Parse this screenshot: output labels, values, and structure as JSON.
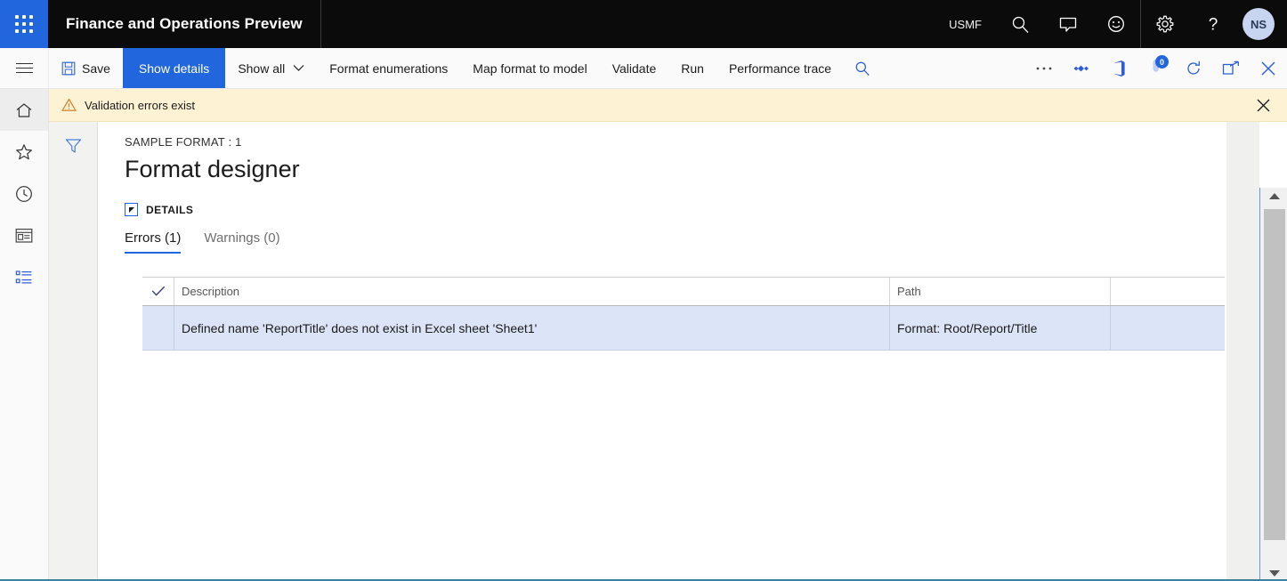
{
  "topbar": {
    "waffle_label": "App launcher",
    "app_title": "Finance and Operations Preview",
    "company": "USMF",
    "icons": [
      {
        "name": "search-icon",
        "label": "Search"
      },
      {
        "name": "message-icon",
        "label": "Messages"
      },
      {
        "name": "feedback-smiley-icon",
        "label": "Feedback"
      },
      {
        "name": "settings-gear-icon",
        "label": "Settings"
      },
      {
        "name": "help-question-icon",
        "label": "Help"
      }
    ],
    "avatar_initials": "NS"
  },
  "toolbar": {
    "hamburger_label": "Expand the navigation pane",
    "save_label": "Save",
    "show_details_label": "Show details",
    "show_all_label": "Show all",
    "show_all_chevron": "⌄",
    "format_enumerations_label": "Format enumerations",
    "map_format_to_model_label": "Map format to model",
    "validate_label": "Validate",
    "run_label": "Run",
    "performance_trace_label": "Performance trace",
    "search_icon_label": "Search",
    "overflow_label": "···",
    "right_icons": [
      {
        "name": "overflow-ellipsis-icon",
        "label": "More options"
      },
      {
        "name": "attachments-diamond-icon",
        "label": "Attachments"
      },
      {
        "name": "office-app-icon",
        "label": "Open in Microsoft Office"
      },
      {
        "name": "notifications-icon",
        "label": "Notifications",
        "badge": "0"
      },
      {
        "name": "refresh-icon",
        "label": "Refresh"
      },
      {
        "name": "popout-icon",
        "label": "Open in new window"
      },
      {
        "name": "close-icon",
        "label": "Close"
      }
    ]
  },
  "rail": {
    "items": [
      {
        "name": "sidebar-item-home",
        "label": "Home",
        "active": true
      },
      {
        "name": "sidebar-item-favorites",
        "label": "Favorites",
        "active": false
      },
      {
        "name": "sidebar-item-recent",
        "label": "Recent",
        "active": false
      },
      {
        "name": "sidebar-item-workspaces",
        "label": "Workspaces",
        "active": false
      },
      {
        "name": "sidebar-item-modules",
        "label": "Modules",
        "active": false
      }
    ]
  },
  "message_bar": {
    "text": "Validation errors exist",
    "icon": "warning-triangle-icon",
    "close_label": "✕"
  },
  "filter_strip": {
    "filter_label": "Filter"
  },
  "page": {
    "caption": "SAMPLE FORMAT : 1",
    "title": "Format designer",
    "section_label": "DETAILS"
  },
  "tabs": [
    {
      "label": "Errors (1)",
      "active": true
    },
    {
      "label": "Warnings (0)",
      "active": false
    }
  ],
  "grid": {
    "columns": [
      {
        "key": "check",
        "label": ""
      },
      {
        "key": "description",
        "label": "Description"
      },
      {
        "key": "path",
        "label": "Path"
      }
    ],
    "rows": [
      {
        "description": "Defined name 'ReportTitle' does not exist in Excel sheet 'Sheet1'",
        "path": "Format: Root/Report/Title"
      }
    ]
  },
  "scrollbar": {
    "up_label": "Scroll up",
    "down_label": "Scroll down",
    "thumb_label": "Scroll thumb"
  },
  "colors": {
    "brand_blue": "#2266dd",
    "topbar_black": "#0b0b0b",
    "warning_bg": "#fdf3d4",
    "row_selected": "#dce5f7",
    "accent_underline": "#2266dd"
  }
}
